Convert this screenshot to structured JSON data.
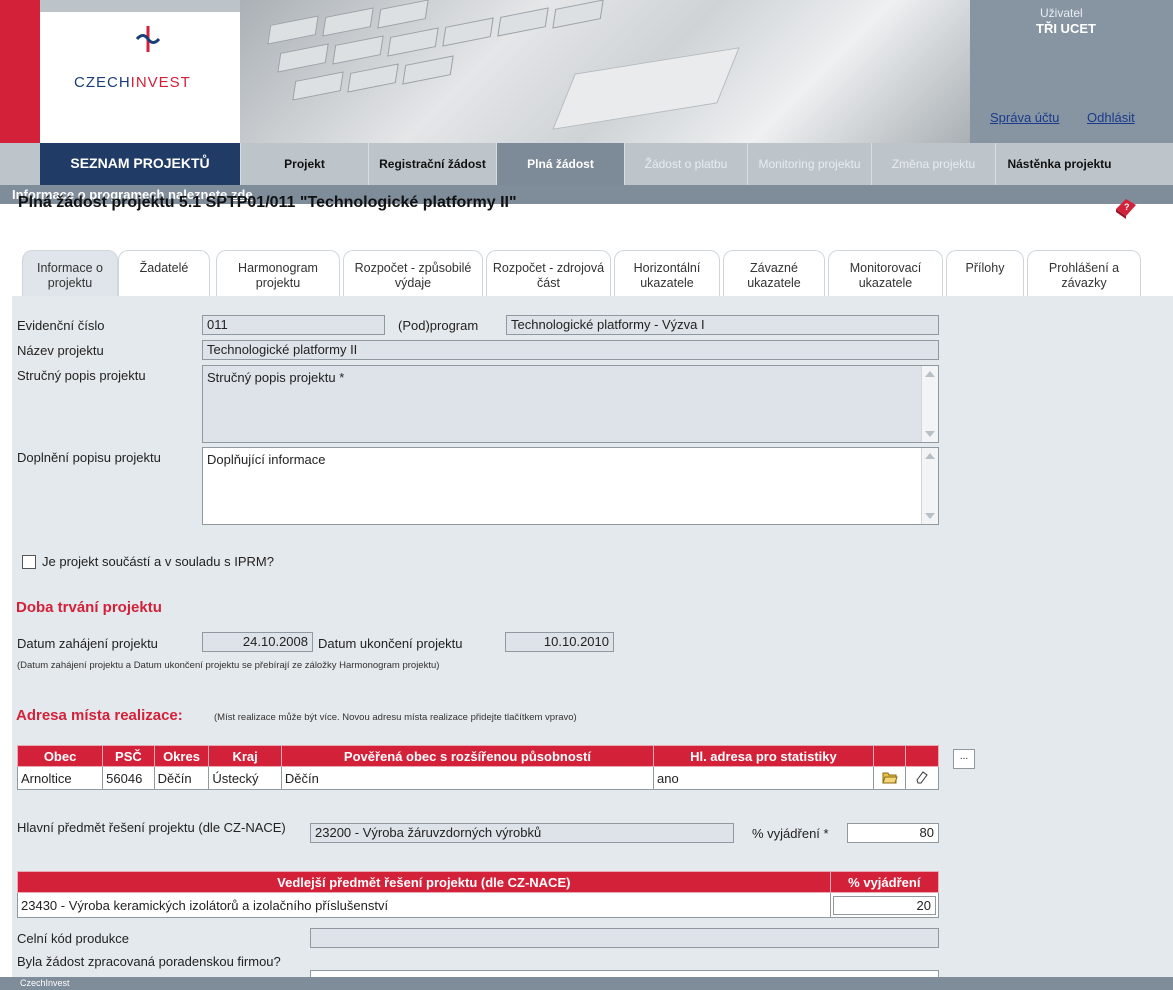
{
  "header": {
    "logo_text_a": "CZECH",
    "logo_text_b": "INVEST",
    "user_label": "Uživatel",
    "user_name": "TŘI UCET",
    "account_link": "Správa účtu",
    "logout_link": "Odhlásit"
  },
  "nav": {
    "home": "SEZNAM PROJEKTŮ",
    "items": [
      {
        "label": "Projekt"
      },
      {
        "label": "Registrační žádost"
      },
      {
        "label": "Plná žádost"
      },
      {
        "label": "Žádost o platbu"
      },
      {
        "label": "Monitoring projektu"
      },
      {
        "label": "Změna projektu"
      },
      {
        "label": "Nástěnka projektu"
      }
    ]
  },
  "infobar": {
    "text": "Informace o programech naleznete ",
    "link": "zde"
  },
  "page_title": "Plná žádost projektu 5.1 SPTP01/011 \"Technologické platformy II\"",
  "tabs": [
    {
      "label": "Informace o projektu"
    },
    {
      "label": "Žadatelé"
    },
    {
      "label": "Harmonogram projektu"
    },
    {
      "label": "Rozpočet - způsobilé výdaje"
    },
    {
      "label": "Rozpočet - zdrojová část"
    },
    {
      "label": "Horizontální ukazatele"
    },
    {
      "label": "Závazné ukazatele"
    },
    {
      "label": "Monitorovací ukazatele"
    },
    {
      "label": "Přílohy"
    },
    {
      "label": "Prohlášení a závazky"
    }
  ],
  "form": {
    "ev_label": "Evidenční číslo",
    "ev_value": "011",
    "program_label": "(Pod)program",
    "program_value": "Technologické platformy - Výzva I",
    "name_label": "Název projektu",
    "name_value": "Technologické platformy II",
    "desc_label": "Stručný popis projektu",
    "desc_value": "Stručný popis projektu *",
    "extra_label": "Doplnění popisu projektu",
    "extra_value": "Doplňující informace",
    "iprm_label": "Je projekt součástí a v souladu s IPRM?",
    "duration_heading": "Doba trvání projektu",
    "start_label": "Datum zahájení projektu",
    "start_value": "24.10.2008",
    "end_label": "Datum ukončení projektu",
    "end_value": "10.10.2010",
    "date_note": "(Datum zahájení projektu a Datum ukončení projektu se přebírají ze záložky Harmonogram projektu)",
    "address_heading": "Adresa místa realizace:",
    "address_note": "(Míst realizace může být více. Novou adresu místa realizace přidejte tlačítkem vpravo)",
    "address_columns": [
      "Obec",
      "PSČ",
      "Okres",
      "Kraj",
      "Pověřená obec s rozšířenou působností",
      "Hl. adresa pro statistiky"
    ],
    "address_row": [
      "Arnoltice",
      "56046",
      "Děčín",
      "Ústecký",
      "Děčín",
      "ano"
    ],
    "more_button": "...",
    "main_subject_label": "Hlavní předmět řešení projektu (dle CZ-NACE)",
    "main_subject_value": "23200 - Výroba žáruvzdorných výrobků",
    "percent_label": "% vyjádření *",
    "percent_value": "80",
    "side_columns": [
      "Vedlejší předmět řešení projektu (dle CZ-NACE)",
      "% vyjádření"
    ],
    "side_row": [
      "23430 - Výroba keramických izolátorů a izolačního příslušenství",
      "20"
    ],
    "customs_label": "Celní kód produkce",
    "advisory_label": "Byla žádost zpracovaná poradenskou firmou?"
  },
  "footer": "CzechInvest",
  "colors": {
    "accent": "#d3213a",
    "nav_dark": "#1f3b66",
    "nav_bg": "#bdc5cb",
    "panel": "#e4e9ed"
  }
}
